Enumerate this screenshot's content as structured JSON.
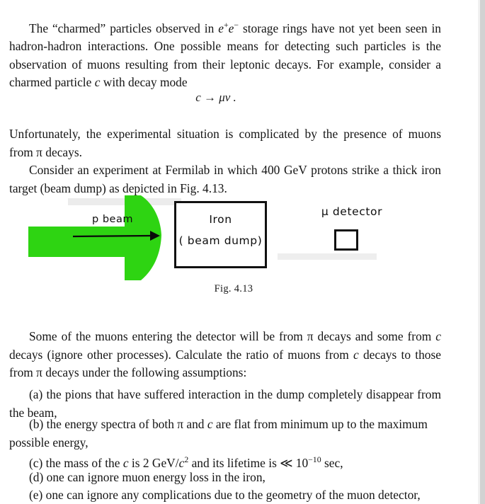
{
  "document": {
    "paragraphs": {
      "intro": "The “charmed” particles observed in e⁺e⁻ storage rings have not yet been seen in hadron-hadron interactions. One possible means for detecting such particles is the observation of muons resulting from their leptonic decays. For example, consider a charmed particle c with decay mode",
      "formula": "c → μν .",
      "complication": "Unfortunately, the experimental situation is complicated by the presence of muons from π decays.",
      "setup": "Consider an experiment at Fermilab in which 400 GeV protons strike a thick iron target (beam dump) as depicted in Fig. 4.13.",
      "question": "Some of the muons entering the detector will be from π decays and some from c decays (ignore other processes). Calculate the ratio of muons from c decays to those from π decays under the following assumptions:"
    },
    "assumptions": [
      "(a) the pions that have suffered interaction in the dump completely disappear from the beam,",
      "(b) the energy spectra of both π and c are flat from minimum up to the maximum possible energy,",
      "(c) the mass of the c is 2 GeV/c² and its lifetime is ≪ 10⁻¹⁰ sec,",
      "(d) one can ignore muon energy loss in the iron,",
      "(e) one can ignore any complications due to the geometry of the muon detector,"
    ]
  },
  "figure": {
    "caption": "Fig. 4.13",
    "beam_label": "p beam",
    "iron_label_line1": "Iron",
    "iron_label_line2": "( beam dump)",
    "detector_label": "μ detector",
    "arrow_color": "#2ed412",
    "ink_color": "#111111"
  }
}
